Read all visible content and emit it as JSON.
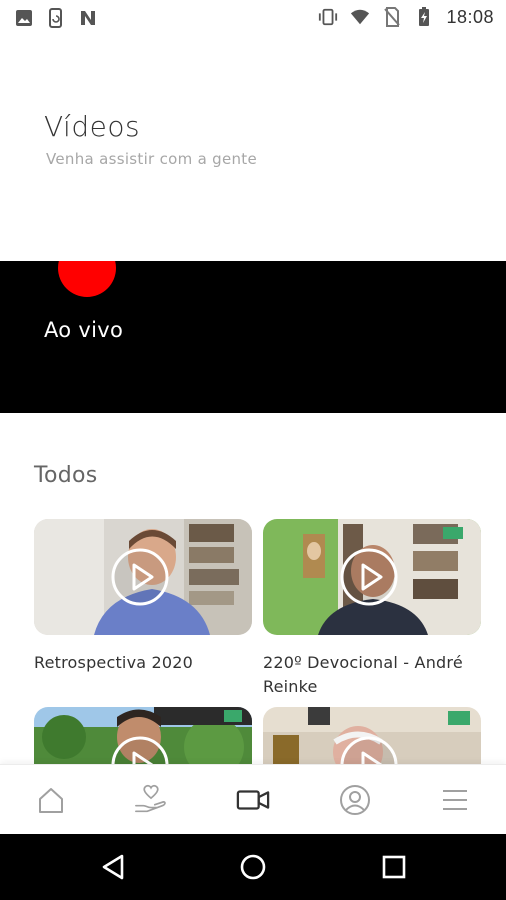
{
  "status_bar": {
    "time": "18:08",
    "left_icons": [
      "image-icon",
      "phone-sync-icon",
      "n-app-icon"
    ],
    "right_icons": [
      "vibrate-icon",
      "wifi-icon",
      "no-sim-icon",
      "battery-charging-icon"
    ]
  },
  "header": {
    "title": "Vídeos",
    "subtitle": "Venha assistir com a gente"
  },
  "live": {
    "label": "Ao vivo",
    "dot_color": "#ff0000"
  },
  "section": {
    "title": "Todos"
  },
  "videos": [
    {
      "title": "Retrospectiva 2020"
    },
    {
      "title": "220º Devocional - André Reinke"
    },
    {
      "title": ""
    },
    {
      "title": ""
    }
  ],
  "bottom_nav": {
    "items": [
      {
        "icon": "home-icon"
      },
      {
        "icon": "donation-heart-hand-icon"
      },
      {
        "icon": "video-camera-icon",
        "active": true
      },
      {
        "icon": "profile-icon"
      },
      {
        "icon": "menu-icon"
      }
    ]
  },
  "system_nav": {
    "buttons": [
      "back-icon",
      "home-circle-icon",
      "recents-icon"
    ]
  }
}
